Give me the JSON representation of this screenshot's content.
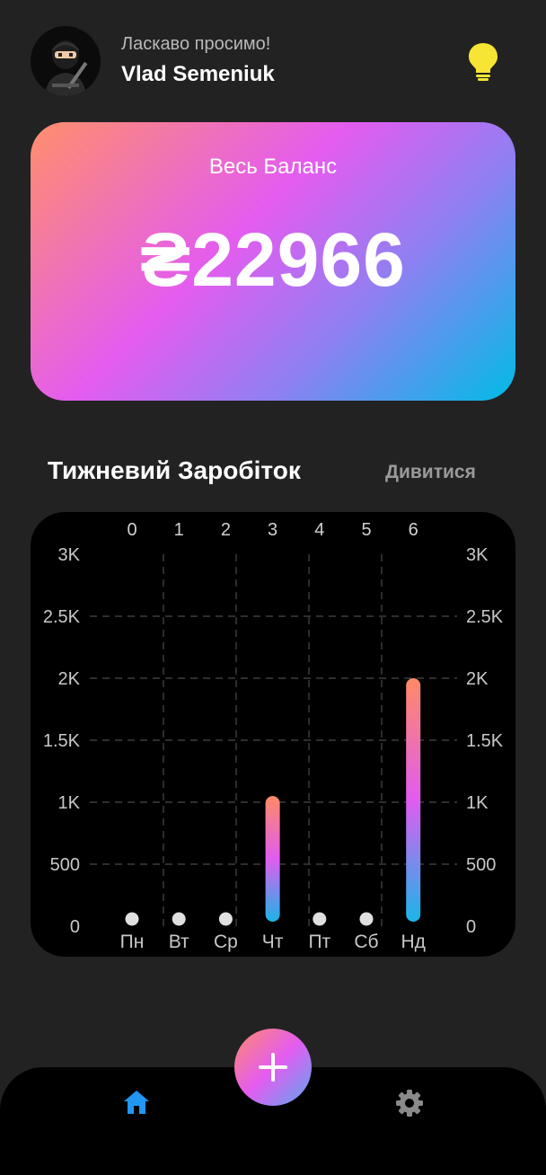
{
  "header": {
    "greeting": "Ласкаво просимо!",
    "user_name": "Vlad Semeniuk",
    "avatar_icon": "ninja-avatar",
    "theme_icon": "lightbulb-icon"
  },
  "balance": {
    "label": "Весь Баланс",
    "value": "₴22966"
  },
  "weekly": {
    "title": "Тижневий Заробіток",
    "view_label": "Дивитися"
  },
  "chart_data": {
    "type": "bar",
    "categories": [
      "Пн",
      "Вт",
      "Ср",
      "Чт",
      "Пт",
      "Сб",
      "Нд"
    ],
    "top_ticks": [
      "0",
      "1",
      "2",
      "3",
      "4",
      "5",
      "6"
    ],
    "values": [
      0,
      0,
      0,
      1050,
      0,
      0,
      2000
    ],
    "y_ticks": [
      "0",
      "500",
      "1K",
      "1.5K",
      "2K",
      "2.5K",
      "3K"
    ],
    "ylim": [
      0,
      3000
    ],
    "grid": true,
    "colors": {
      "gradient_top": "#ff8a65",
      "gradient_mid": "#e15cf0",
      "gradient_bottom": "#1bb5e8",
      "zero_dot": "#e0e0e0"
    }
  },
  "nav": {
    "home_icon": "home-icon",
    "add_icon": "plus-icon",
    "settings_icon": "gear-icon",
    "active_color": "#2196f3",
    "inactive_color": "#8a8a8a"
  }
}
